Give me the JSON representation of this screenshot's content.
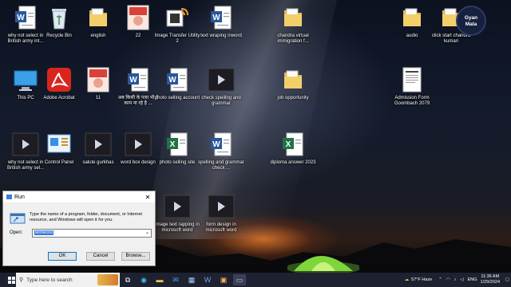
{
  "desktop": {
    "icons": [
      {
        "label": "why not select in British army int...",
        "icon": "word-doc-icon"
      },
      {
        "label": "Recycle Bin",
        "icon": "recycle-bin-icon"
      },
      {
        "label": "english",
        "icon": "folder-icon"
      },
      {
        "label": "22",
        "icon": "image-icon"
      },
      {
        "label": "Image Transfer Utility 2",
        "icon": "app-icon"
      },
      {
        "label": "text wraping inword",
        "icon": "word-doc-icon"
      },
      {
        "label": "chandra virtual immigration f...",
        "icon": "folder-icon"
      },
      {
        "label": "audio",
        "icon": "folder-icon"
      },
      {
        "label": "click start chandra kumari",
        "icon": "folder-icon"
      },
      {
        "label": "This PC",
        "icon": "pc-icon"
      },
      {
        "label": "Adobe Acrobat",
        "icon": "acrobat-icon"
      },
      {
        "label": "11",
        "icon": "image-icon"
      },
      {
        "label": "अब किसी के पास भी है काम ना रहे है ...",
        "icon": "word-doc-icon"
      },
      {
        "label": "photo selling account",
        "icon": "word-doc-icon"
      },
      {
        "label": "check spelling and grammar",
        "icon": "video-icon"
      },
      {
        "label": "job opportunity",
        "icon": "folder-icon"
      },
      {
        "label": "Admission Form Goombach 2079",
        "icon": "document-icon"
      },
      {
        "label": "why not select in British army sel...",
        "icon": "video-icon"
      },
      {
        "label": "Control Panel",
        "icon": "control-panel-icon"
      },
      {
        "label": "salute gurkhas",
        "icon": "video-icon"
      },
      {
        "label": "word box design",
        "icon": "video-icon"
      },
      {
        "label": "photo selling site",
        "icon": "excel-icon"
      },
      {
        "label": "spelling and grammar check ...",
        "icon": "word-doc-icon"
      },
      {
        "label": "diploma answer 2023",
        "icon": "excel-icon"
      },
      {
        "label": "image text rapping in microsoft word",
        "icon": "video-icon"
      },
      {
        "label": "form design in microsoft word",
        "icon": "video-icon"
      }
    ]
  },
  "logo": {
    "line1": "Gyan",
    "line2": "Mala"
  },
  "run_dialog": {
    "title": "Run",
    "message": "Type the name of a program, folder, document, or Internet resource, and Windows will open it for you.",
    "open_label": "Open:",
    "open_value": "winword",
    "ok": "OK",
    "cancel": "Cancel",
    "browse": "Browse..."
  },
  "taskbar": {
    "search_placeholder": "Type here to search",
    "weather": "57°F Haze",
    "language": "ENG",
    "time": "11:36 AM",
    "date": "1/29/2024"
  }
}
